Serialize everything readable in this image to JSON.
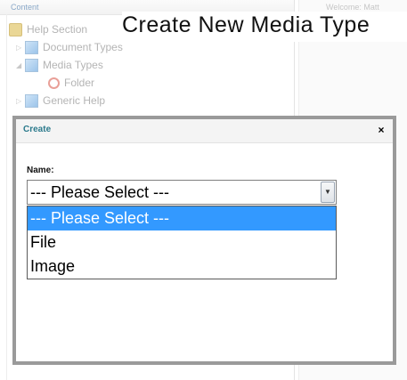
{
  "overlay_title": "Create New Media Type",
  "background": {
    "content_panel_title": "Content",
    "right_panel_title": "Welcome: Matt",
    "tree": [
      {
        "label": "Help Section",
        "icon": "folder-icon",
        "expander": ""
      },
      {
        "label": "Document Types",
        "icon": "document-types-icon",
        "expander": "▷"
      },
      {
        "label": "Media Types",
        "icon": "media-types-icon",
        "expander": "◢"
      },
      {
        "label": "Folder",
        "icon": "folder-circle-icon",
        "expander": ""
      },
      {
        "label": "Generic Help",
        "icon": "generic-help-icon",
        "expander": "▷"
      }
    ]
  },
  "modal": {
    "title": "Create",
    "close_glyph": "×",
    "name_label": "Name:",
    "select": {
      "value": "--- Please Select ---",
      "arrow_glyph": "▼",
      "options": [
        {
          "label": "--- Please Select ---",
          "selected": true
        },
        {
          "label": "File",
          "selected": false
        },
        {
          "label": "Image",
          "selected": false
        }
      ]
    }
  },
  "colors": {
    "selection_highlight": "#3399ff",
    "modal_title": "#2b7a8c",
    "modal_border": "#9a9a9a"
  }
}
